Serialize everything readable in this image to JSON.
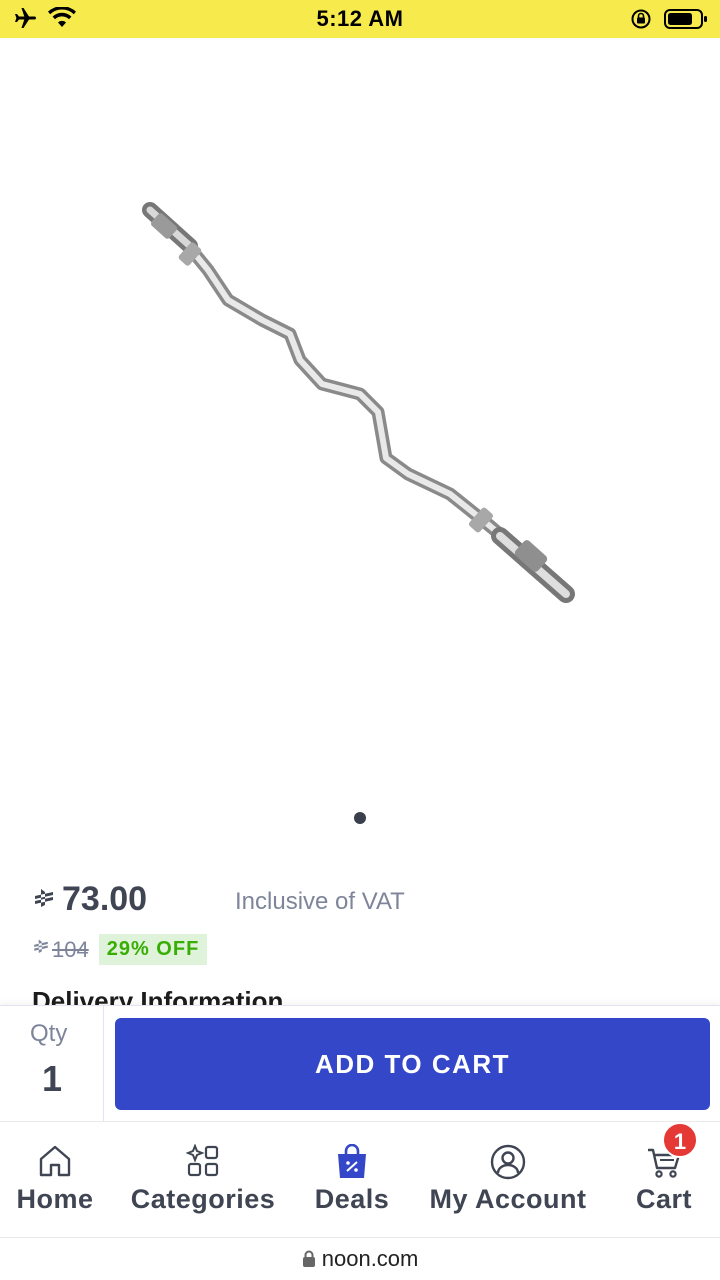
{
  "status_bar": {
    "time": "5:12 AM",
    "left_icons": [
      "airplane-icon",
      "wifi-icon"
    ],
    "right_icons": [
      "rotation-lock-icon",
      "battery-icon"
    ],
    "background": "#f6ea4c"
  },
  "product": {
    "image_description_icon": "ez-curl-bar",
    "carousel_active_index": 0,
    "carousel_total": 1
  },
  "price": {
    "currency_icon": "riyal-icon",
    "currency_symbol": "⃁",
    "current": "73.00",
    "vat_note": "Inclusive of VAT",
    "old_price": "104",
    "discount": "29% OFF"
  },
  "delivery": {
    "heading": "Delivery Information"
  },
  "cart_bar": {
    "qty_label": "Qty",
    "qty_value": "1",
    "add_to_cart_label": "ADD TO CART",
    "button_color": "#3447c9"
  },
  "bottom_nav": {
    "items": [
      {
        "label": "Home",
        "icon": "home-icon"
      },
      {
        "label": "Categories",
        "icon": "categories-icon"
      },
      {
        "label": "Deals",
        "icon": "deals-bag-icon"
      },
      {
        "label": "My Account",
        "icon": "account-icon"
      },
      {
        "label": "Cart",
        "icon": "cart-icon",
        "badge": "1"
      }
    ]
  },
  "url_bar": {
    "url": "noon.com",
    "icon": "lock-icon"
  }
}
